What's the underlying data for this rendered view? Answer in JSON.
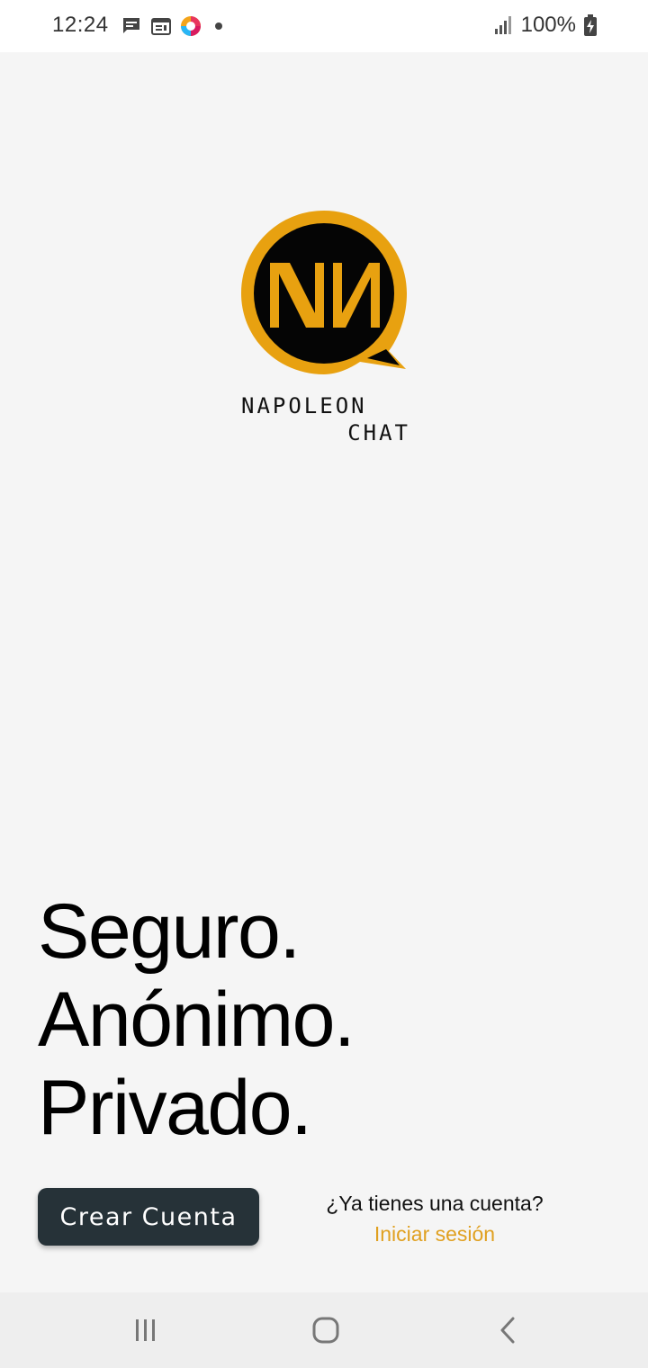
{
  "status_bar": {
    "time": "12:24",
    "battery": "100%",
    "icons": [
      "message-icon",
      "calendar-icon",
      "app-icon",
      "notification-dot-icon",
      "signal-icon",
      "battery-charging-icon"
    ]
  },
  "logo": {
    "monogram": "NN",
    "line1": "NAPOLEON",
    "line2": "CHAT",
    "colors": {
      "ring": "#E8A110",
      "fill": "#050505"
    }
  },
  "tagline": {
    "line1": "Seguro.",
    "line2": "Anónimo.",
    "line3": "Privado."
  },
  "actions": {
    "create_account": "Crear Cuenta",
    "have_account": "¿Ya tienes una cuenta?",
    "login": "Iniciar sesión"
  },
  "nav_bar": {
    "icons": [
      "recent-apps-icon",
      "home-icon",
      "back-icon"
    ]
  },
  "colors": {
    "background": "#F5F5F5",
    "button": "#263238",
    "link": "#E0A020"
  }
}
